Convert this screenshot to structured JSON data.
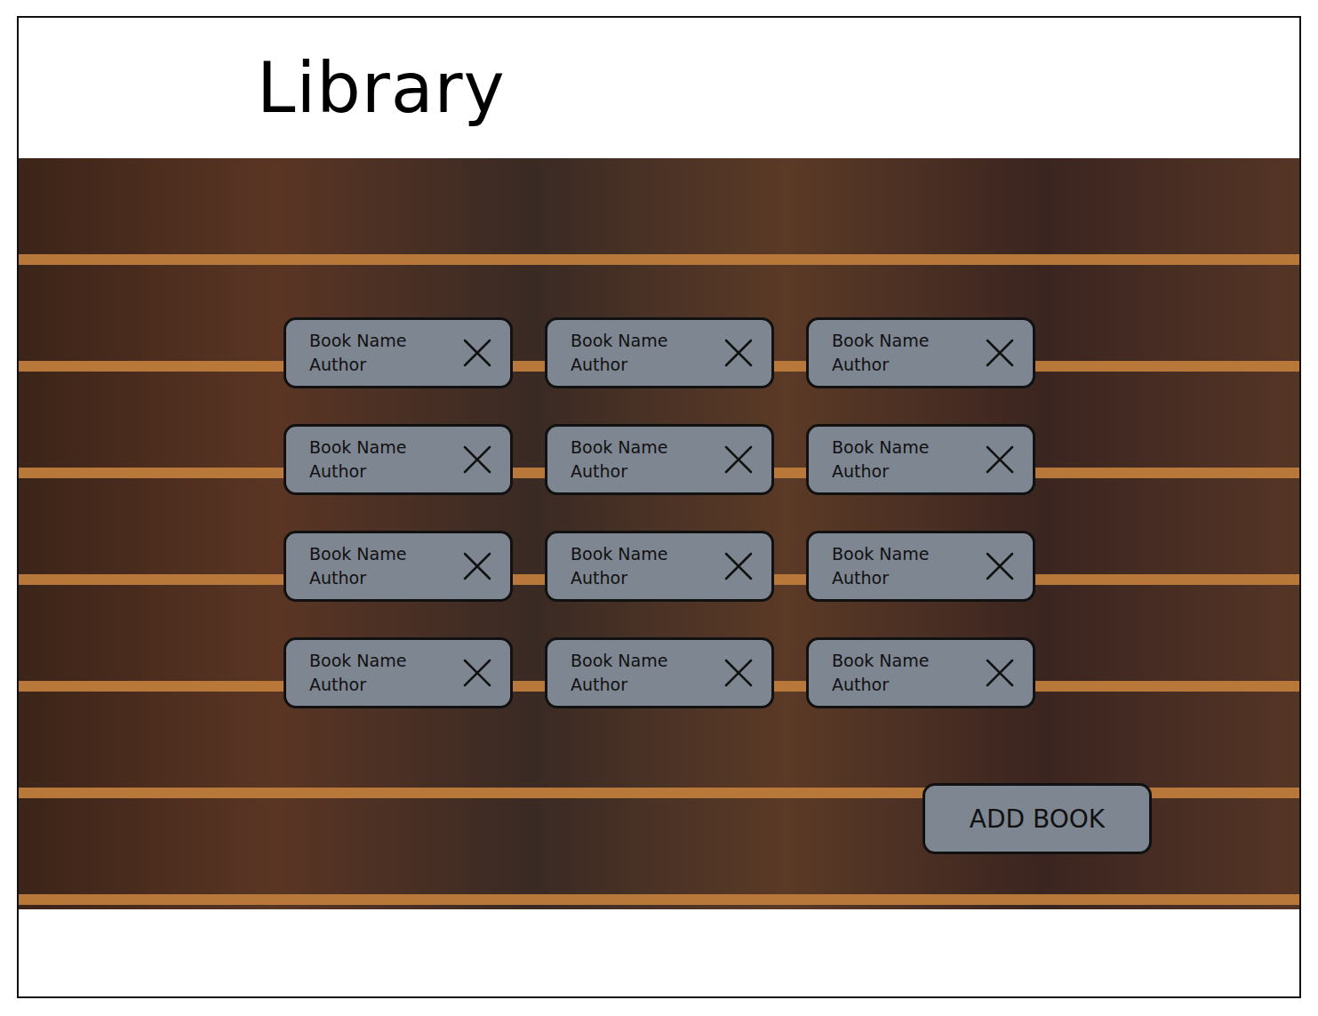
{
  "title": "Library",
  "books": [
    {
      "name": "Book Name",
      "author": "Author"
    },
    {
      "name": "Book Name",
      "author": "Author"
    },
    {
      "name": "Book Name",
      "author": "Author"
    },
    {
      "name": "Book Name",
      "author": "Author"
    },
    {
      "name": "Book Name",
      "author": "Author"
    },
    {
      "name": "Book Name",
      "author": "Author"
    },
    {
      "name": "Book Name",
      "author": "Author"
    },
    {
      "name": "Book Name",
      "author": "Author"
    },
    {
      "name": "Book Name",
      "author": "Author"
    },
    {
      "name": "Book Name",
      "author": "Author"
    },
    {
      "name": "Book Name",
      "author": "Author"
    },
    {
      "name": "Book Name",
      "author": "Author"
    }
  ],
  "add_button": "ADD BOOK"
}
